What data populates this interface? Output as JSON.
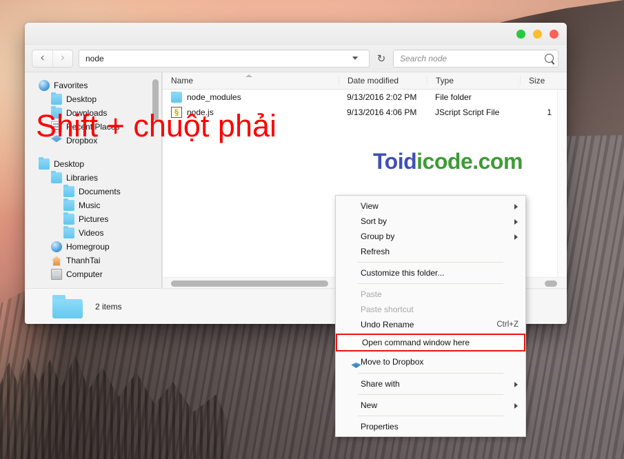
{
  "desktop": {
    "wallpaper_name": "yosemite-el-capitan"
  },
  "window": {
    "title": "node",
    "lights": [
      {
        "name": "zoom",
        "color": "#27c93f"
      },
      {
        "name": "minimize",
        "color": "#ffbd2e"
      },
      {
        "name": "close",
        "color": "#ff6157"
      }
    ],
    "toolbar": {
      "back_icon": "‹",
      "forward_icon": "›",
      "address_value": "node",
      "refresh_icon": "↻",
      "search_placeholder": "Search node"
    },
    "sidebar": {
      "items": [
        {
          "label": "Favorites",
          "icon": "globe-icon",
          "indent": 0
        },
        {
          "label": "Desktop",
          "icon": "folder-icon",
          "indent": 1
        },
        {
          "label": "Downloads",
          "icon": "folder-icon",
          "indent": 1
        },
        {
          "label": "Recent Places",
          "icon": "recent-icon",
          "indent": 1
        },
        {
          "label": "Dropbox",
          "icon": "dropbox-icon",
          "indent": 1
        },
        {
          "label": "Desktop",
          "icon": "folder-icon",
          "indent": 0
        },
        {
          "label": "Libraries",
          "icon": "folder-icon",
          "indent": 1
        },
        {
          "label": "Documents",
          "icon": "folder-icon",
          "indent": 2
        },
        {
          "label": "Music",
          "icon": "folder-icon",
          "indent": 2
        },
        {
          "label": "Pictures",
          "icon": "folder-icon",
          "indent": 2
        },
        {
          "label": "Videos",
          "icon": "folder-icon",
          "indent": 2
        },
        {
          "label": "Homegroup",
          "icon": "globe-icon",
          "indent": 1
        },
        {
          "label": "ThanhTai",
          "icon": "home-icon",
          "indent": 1
        },
        {
          "label": "Computer",
          "icon": "computer-icon",
          "indent": 1
        }
      ]
    },
    "filepane": {
      "columns": [
        {
          "key": "name",
          "label": "Name"
        },
        {
          "key": "date",
          "label": "Date modified"
        },
        {
          "key": "type",
          "label": "Type"
        },
        {
          "key": "size",
          "label": "Size"
        }
      ],
      "sort_column": "Name",
      "sort_direction": "ascending",
      "rows": [
        {
          "name": "node_modules",
          "icon": "folder-icon",
          "date": "9/13/2016 2:02 PM",
          "type": "File folder",
          "size": ""
        },
        {
          "name": "node.js",
          "icon": "script-icon",
          "date": "9/13/2016 4:06 PM",
          "type": "JScript Script File",
          "size": "1"
        }
      ]
    },
    "statusbar": {
      "icon": "folder-icon",
      "text": "2 items"
    }
  },
  "context_menu": {
    "items": [
      {
        "id": "view",
        "label": "View",
        "submenu": true,
        "disabled": false,
        "accel": "",
        "icon": ""
      },
      {
        "id": "sortby",
        "label": "Sort by",
        "submenu": true,
        "disabled": false,
        "accel": "",
        "icon": ""
      },
      {
        "id": "groupby",
        "label": "Group by",
        "submenu": true,
        "disabled": false,
        "accel": "",
        "icon": ""
      },
      {
        "id": "refresh",
        "label": "Refresh",
        "submenu": false,
        "disabled": false,
        "accel": "",
        "icon": ""
      },
      {
        "id": "sep1",
        "separator": true
      },
      {
        "id": "customize",
        "label": "Customize this folder...",
        "submenu": false,
        "disabled": false,
        "accel": "",
        "icon": ""
      },
      {
        "id": "sep2",
        "separator": true
      },
      {
        "id": "paste",
        "label": "Paste",
        "submenu": false,
        "disabled": true,
        "accel": "",
        "icon": ""
      },
      {
        "id": "pasteshort",
        "label": "Paste shortcut",
        "submenu": false,
        "disabled": true,
        "accel": "",
        "icon": ""
      },
      {
        "id": "undorename",
        "label": "Undo Rename",
        "submenu": false,
        "disabled": false,
        "accel": "Ctrl+Z",
        "icon": ""
      },
      {
        "id": "opencmd",
        "label": "Open command window here",
        "submenu": false,
        "disabled": false,
        "accel": "",
        "icon": "",
        "highlighted": true
      },
      {
        "id": "dropbox",
        "label": "Move to Dropbox",
        "submenu": false,
        "disabled": false,
        "accel": "",
        "icon": "dropbox-icon"
      },
      {
        "id": "sep3",
        "separator": true
      },
      {
        "id": "sharewith",
        "label": "Share with",
        "submenu": true,
        "disabled": false,
        "accel": "",
        "icon": ""
      },
      {
        "id": "sep4",
        "separator": true
      },
      {
        "id": "new",
        "label": "New",
        "submenu": true,
        "disabled": false,
        "accel": "",
        "icon": ""
      },
      {
        "id": "sep5",
        "separator": true
      },
      {
        "id": "properties",
        "label": "Properties",
        "submenu": false,
        "disabled": false,
        "accel": "",
        "icon": ""
      }
    ],
    "highlight_color": "#ee1111"
  },
  "annotations": {
    "instruction": "Shift + chuột phải",
    "instruction_color": "#ff0000",
    "watermark_part1": "Toid",
    "watermark_part2": "icode.com",
    "watermark_color1": "#3f51b5",
    "watermark_color2": "#3d9b35"
  }
}
